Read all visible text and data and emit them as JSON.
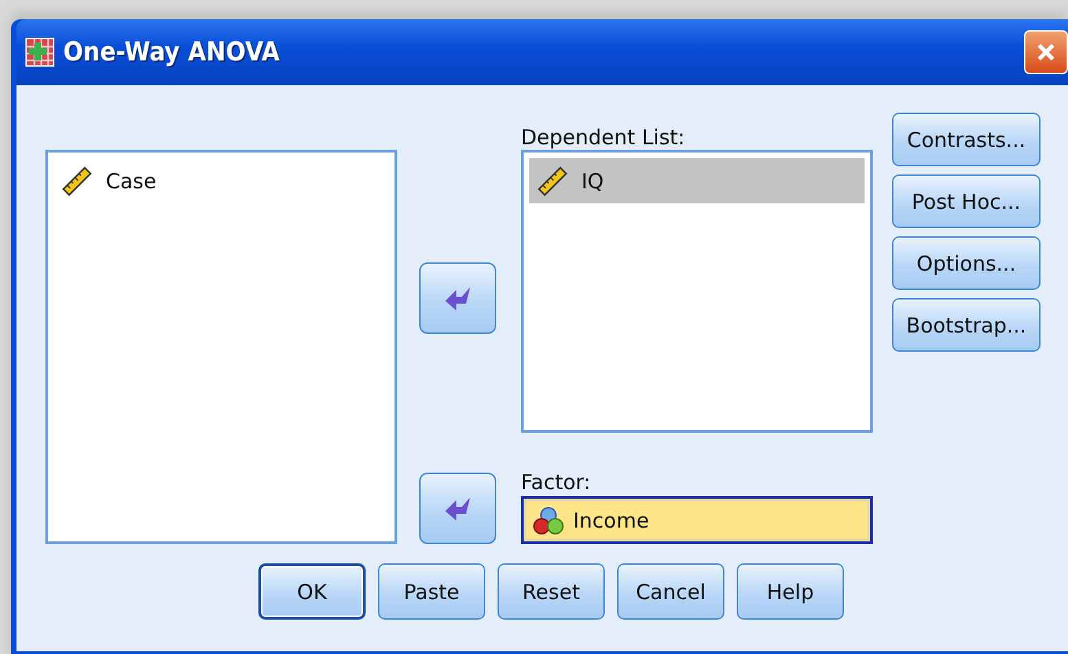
{
  "window": {
    "title": "One-Way ANOVA"
  },
  "source_list": {
    "items": [
      {
        "label": "Case",
        "kind": "scale",
        "selected": false
      }
    ]
  },
  "dependent_list": {
    "label": "Dependent List:",
    "items": [
      {
        "label": "IQ",
        "kind": "scale",
        "selected": true
      }
    ]
  },
  "factor": {
    "label": "Factor:",
    "value": "Income",
    "kind": "nominal"
  },
  "side_buttons": [
    {
      "label": "Contrasts..."
    },
    {
      "label": "Post Hoc..."
    },
    {
      "label": "Options..."
    },
    {
      "label": "Bootstrap..."
    }
  ],
  "bottom_buttons": [
    {
      "label": "OK",
      "focused": true
    },
    {
      "label": "Paste",
      "focused": false
    },
    {
      "label": "Reset",
      "focused": false
    },
    {
      "label": "Cancel",
      "focused": false
    },
    {
      "label": "Help",
      "focused": false
    }
  ]
}
